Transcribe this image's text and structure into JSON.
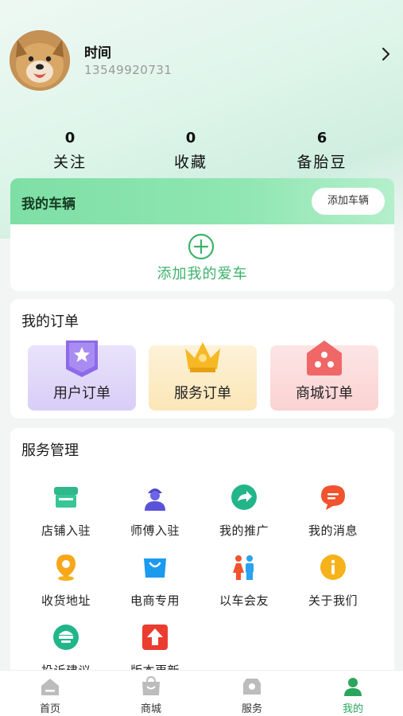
{
  "profile": {
    "name": "时间",
    "phone": "13549920731"
  },
  "stats": [
    {
      "value": "0",
      "label": "关注"
    },
    {
      "value": "0",
      "label": "收藏"
    },
    {
      "value": "6",
      "label": "备胎豆"
    }
  ],
  "vehicle": {
    "title": "我的车辆",
    "add_button": "添加车辆",
    "add_car_label": "添加我的爱车"
  },
  "orders": {
    "title": "我的订单",
    "items": [
      {
        "label": "用户订单",
        "icon": "user-order-icon"
      },
      {
        "label": "服务订单",
        "icon": "crown-icon"
      },
      {
        "label": "商城订单",
        "icon": "shop-house-icon"
      }
    ]
  },
  "services": {
    "title": "服务管理",
    "items": [
      {
        "label": "店铺入驻",
        "icon": "store-icon"
      },
      {
        "label": "师傅入驻",
        "icon": "worker-icon"
      },
      {
        "label": "我的推广",
        "icon": "share-icon"
      },
      {
        "label": "我的消息",
        "icon": "message-icon"
      },
      {
        "label": "收货地址",
        "icon": "location-icon"
      },
      {
        "label": "电商专用",
        "icon": "shopping-bag-icon"
      },
      {
        "label": "以车会友",
        "icon": "people-icon"
      },
      {
        "label": "关于我们",
        "icon": "info-icon"
      },
      {
        "label": "投诉建议",
        "icon": "complaint-icon"
      },
      {
        "label": "版本更新",
        "icon": "update-icon"
      }
    ]
  },
  "tabbar": [
    {
      "label": "首页",
      "icon": "home-icon",
      "active": false
    },
    {
      "label": "商城",
      "icon": "mall-icon",
      "active": false
    },
    {
      "label": "服务",
      "icon": "service-icon",
      "active": false
    },
    {
      "label": "我的",
      "icon": "profile-icon",
      "active": true
    }
  ],
  "colors": {
    "accent": "#2aa55c",
    "vehicle_header": "#8fe6b1"
  }
}
